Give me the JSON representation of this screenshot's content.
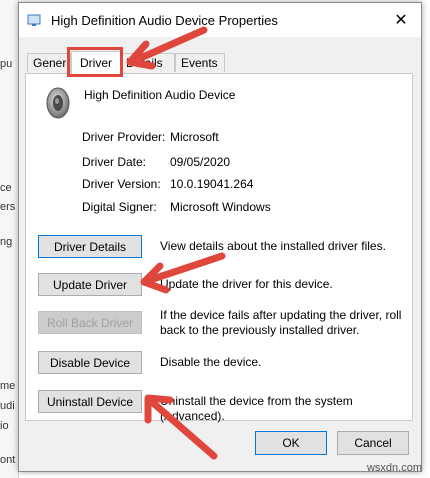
{
  "background_window": {
    "edge_fragments": [
      "pu",
      "ce",
      "ers",
      "ng",
      "me",
      "udi",
      "io",
      "ont"
    ]
  },
  "dialog": {
    "title": "High Definition Audio Device Properties",
    "close_glyph": "✕"
  },
  "tabs": [
    {
      "label": "General"
    },
    {
      "label": "Driver",
      "active": true
    },
    {
      "label": "Details"
    },
    {
      "label": "Events"
    }
  ],
  "device": {
    "name": "High Definition Audio Device",
    "icon": "speaker-icon"
  },
  "driver_info": [
    {
      "label": "Driver Provider:",
      "value": "Microsoft"
    },
    {
      "label": "Driver Date:",
      "value": "09/05/2020"
    },
    {
      "label": "Driver Version:",
      "value": "10.0.19041.264"
    },
    {
      "label": "Digital Signer:",
      "value": "Microsoft Windows"
    }
  ],
  "actions": [
    {
      "label": "Driver Details",
      "description": "View details about the installed driver files.",
      "enabled": true
    },
    {
      "label": "Update Driver",
      "description": "Update the driver for this device.",
      "enabled": true
    },
    {
      "label": "Roll Back Driver",
      "description": "If the device fails after updating the driver, roll back to the previously installed driver.",
      "enabled": false
    },
    {
      "label": "Disable Device",
      "description": "Disable the device.",
      "enabled": true
    },
    {
      "label": "Uninstall Device",
      "description": "Uninstall the device from the system (Advanced).",
      "enabled": true
    }
  ],
  "footer": {
    "ok": "OK",
    "cancel": "Cancel"
  },
  "watermark": "wsxdn.com",
  "colors": {
    "annotation_red": "#e0473c",
    "focus_blue": "#0078d7"
  }
}
